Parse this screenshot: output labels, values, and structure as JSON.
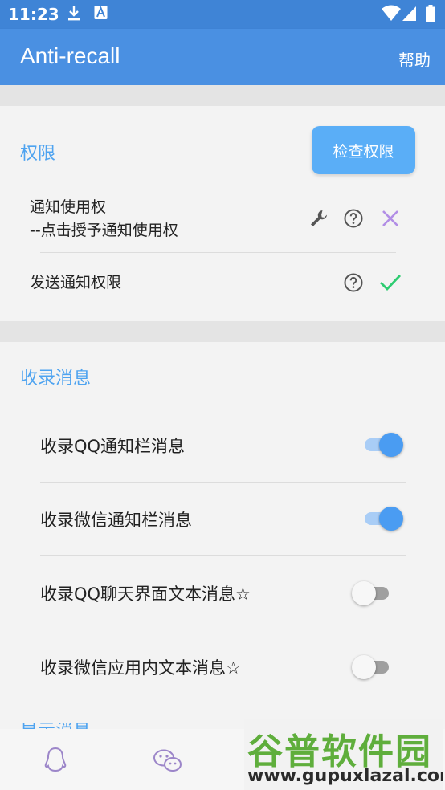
{
  "status_bar": {
    "time": "11:23",
    "icons": [
      "download-icon",
      "font-a-icon",
      "wifi-icon",
      "signal-icon",
      "battery-icon"
    ]
  },
  "app_bar": {
    "title": "Anti-recall",
    "help_label": "帮助"
  },
  "permissions": {
    "title": "权限",
    "check_button_label": "检查权限",
    "items": [
      {
        "line1": "通知使用权",
        "line2": "--点击授予通知使用权",
        "icons": [
          "wrench-icon",
          "help-circle-icon",
          "cross-icon"
        ],
        "granted": false
      },
      {
        "line1": "发送通知权限",
        "icons": [
          "help-circle-icon",
          "check-icon"
        ],
        "granted": true
      }
    ]
  },
  "record": {
    "title": "收录消息",
    "items": [
      {
        "label": "收录QQ通知栏消息",
        "enabled": true
      },
      {
        "label": "收录微信通知栏消息",
        "enabled": true
      },
      {
        "label": "收录QQ聊天界面文本消息☆",
        "enabled": false
      },
      {
        "label": "收录微信应用内文本消息☆",
        "enabled": false
      }
    ],
    "next_section_partial": "显示消息"
  },
  "bottom_nav": {
    "items": [
      "qq-penguin-icon",
      "wechat-icon"
    ]
  },
  "watermark": {
    "main": "谷普软件园",
    "url": "www.gupuxlazal.com"
  },
  "colors": {
    "app_bar": "#4a90e2",
    "status_bar": "#3f84d6",
    "accent": "#4ea3f0",
    "button": "#5aaef7",
    "toggle_on": "#4a9cf2",
    "check_green": "#2ecc71",
    "cross_purple": "#b28ee6"
  }
}
